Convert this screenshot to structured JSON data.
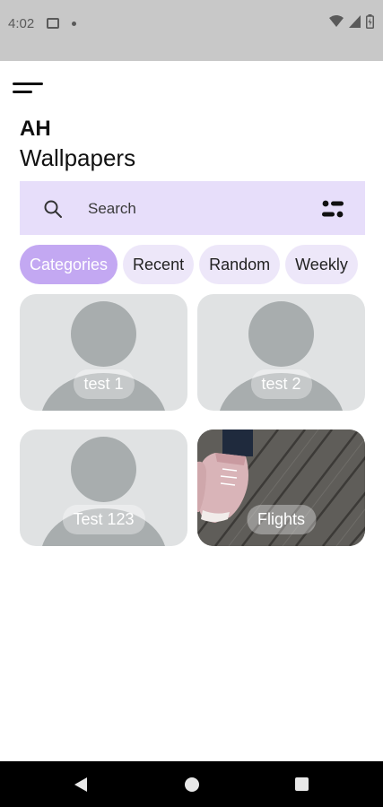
{
  "status_bar": {
    "time": "4:02"
  },
  "header": {
    "title_line1": "AH",
    "title_line2": "Wallpapers"
  },
  "search": {
    "placeholder": "Search"
  },
  "chips": [
    "Categories",
    "Recent",
    "Random",
    "Weekly"
  ],
  "categories": [
    {
      "label": "test 1"
    },
    {
      "label": "test 2"
    },
    {
      "label": "Test 123"
    },
    {
      "label": "Flights"
    }
  ],
  "colors": {
    "accent": "#c3a8f2",
    "search_bg": "#e7defa",
    "chip_bg": "#ede7f9",
    "placeholder_gray": "#a8adae",
    "card_bg": "#e0e2e3"
  }
}
